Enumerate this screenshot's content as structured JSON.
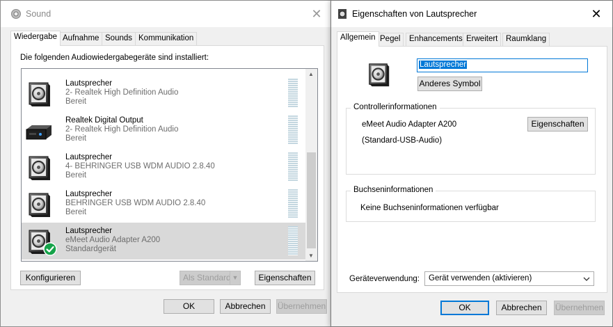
{
  "sound_window": {
    "title": "Sound",
    "tabs": [
      "Wiedergabe",
      "Aufnahme",
      "Sounds",
      "Kommunikation"
    ],
    "intro": "Die folgenden Audiowiedergabegeräte sind installiert:",
    "devices": [
      {
        "name": "Lautsprecher",
        "desc": "2- Realtek High Definition Audio",
        "status": "Bereit",
        "icon": "speaker-icon"
      },
      {
        "name": "Realtek Digital Output",
        "desc": "2- Realtek High Definition Audio",
        "status": "Bereit",
        "icon": "digital-output-icon"
      },
      {
        "name": "Lautsprecher",
        "desc": "4- BEHRINGER USB WDM AUDIO 2.8.40",
        "status": "Bereit",
        "icon": "speaker-icon"
      },
      {
        "name": "Lautsprecher",
        "desc": "BEHRINGER USB WDM AUDIO 2.8.40",
        "status": "Bereit",
        "icon": "speaker-icon"
      },
      {
        "name": "Lautsprecher",
        "desc": "eMeet Audio Adapter A200",
        "status": "Standardgerät",
        "icon": "speaker-icon",
        "default": true
      }
    ],
    "buttons": {
      "configure": "Konfigurieren",
      "set_default": "Als Standard",
      "properties": "Eigenschaften",
      "ok": "OK",
      "cancel": "Abbrechen",
      "apply": "Übernehmen"
    }
  },
  "properties_window": {
    "title": "Eigenschaften von Lautsprecher",
    "tabs": [
      "Allgemein",
      "Pegel",
      "Enhancements",
      "Erweitert",
      "Raumklang"
    ],
    "device_name": "Lautsprecher",
    "change_icon": "Anderes Symbol",
    "controller": {
      "heading": "Controllerinformationen",
      "name": "eMeet Audio Adapter A200",
      "driver": "(Standard-USB-Audio)",
      "properties_button": "Eigenschaften"
    },
    "jack": {
      "heading": "Buchseninformationen",
      "text": "Keine Buchseninformationen verfügbar"
    },
    "usage": {
      "label": "Geräteverwendung:",
      "value": "Gerät verwenden (aktivieren)"
    },
    "buttons": {
      "ok": "OK",
      "cancel": "Abbrechen",
      "apply": "Übernehmen"
    }
  },
  "colors": {
    "desktop": "#2a78d4",
    "selection": "#d9d9d9",
    "accent": "#0078d7",
    "default_check": "#16a34a"
  }
}
